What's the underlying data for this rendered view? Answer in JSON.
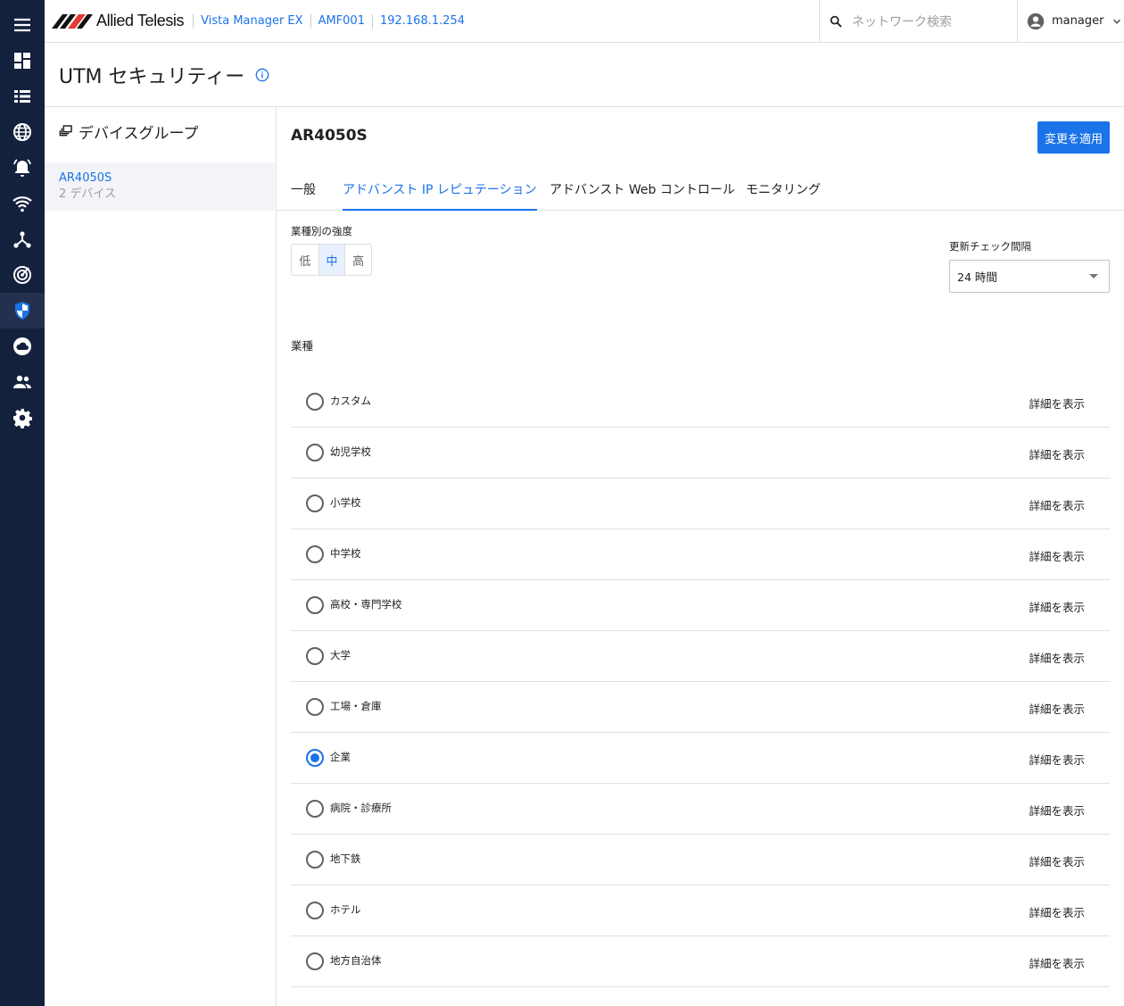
{
  "header": {
    "brand": "Allied Telesis",
    "breadcrumbs": [
      "Vista Manager EX",
      "AMF001",
      "192.168.1.254"
    ],
    "search_placeholder": "ネットワーク検索",
    "user": "manager"
  },
  "nav": {
    "items": [
      {
        "name": "menu-icon"
      },
      {
        "name": "dashboard-icon"
      },
      {
        "name": "list-icon"
      },
      {
        "name": "globe-icon"
      },
      {
        "name": "alarm-icon"
      },
      {
        "name": "wifi-icon"
      },
      {
        "name": "topology-icon"
      },
      {
        "name": "radar-icon"
      },
      {
        "name": "shield-icon"
      },
      {
        "name": "cloud-icon"
      },
      {
        "name": "users-icon"
      },
      {
        "name": "settings-icon"
      }
    ],
    "active": "shield-icon"
  },
  "page": {
    "title": "UTM セキュリティー"
  },
  "left_panel": {
    "title": "デバイスグループ",
    "items": [
      {
        "name": "AR4050S",
        "sub": "2 デバイス"
      }
    ]
  },
  "main": {
    "title": "AR4050S",
    "apply_label": "変更を適用",
    "tabs": [
      {
        "label": "一般",
        "active": false
      },
      {
        "label": "アドバンスト IP レピュテーション",
        "active": true
      },
      {
        "label": "アドバンスト Web コントロール",
        "active": false
      },
      {
        "label": "モニタリング",
        "active": false
      }
    ],
    "strength": {
      "label": "業種別の強度",
      "options": [
        "低",
        "中",
        "高"
      ],
      "selected": "中"
    },
    "interval": {
      "label": "更新チェック間隔",
      "value": "24 時間"
    },
    "industry": {
      "label": "業種",
      "detail_label": "詳細を表示",
      "options": [
        "カスタム",
        "幼児学校",
        "小学校",
        "中学校",
        "高校・専門学校",
        "大学",
        "工場・倉庫",
        "企業",
        "病院・診療所",
        "地下鉄",
        "ホテル",
        "地方自治体"
      ],
      "selected": "企業"
    }
  },
  "colors": {
    "accent": "#1a73e8",
    "rail": "#14213d"
  }
}
